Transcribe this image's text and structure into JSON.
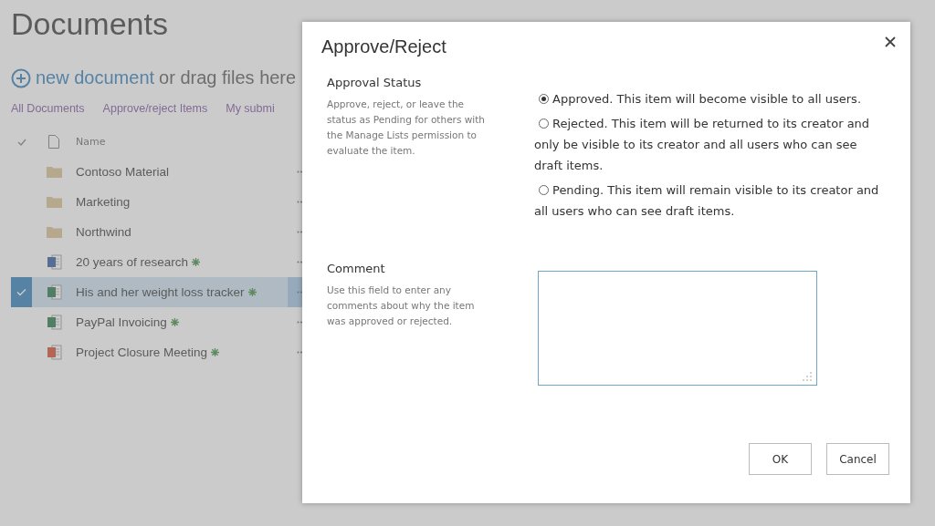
{
  "page": {
    "title": "Documents",
    "new_link": "new document",
    "new_hint": "or drag files here"
  },
  "views": [
    {
      "label": "All Documents"
    },
    {
      "label": "Approve/reject Items"
    },
    {
      "label": "My submi"
    }
  ],
  "list": {
    "column": "Name",
    "rows": [
      {
        "kind": "folder",
        "name": "Contoso Material",
        "new": false,
        "selected": false
      },
      {
        "kind": "folder",
        "name": "Marketing",
        "new": false,
        "selected": false
      },
      {
        "kind": "folder",
        "name": "Northwind",
        "new": false,
        "selected": false
      },
      {
        "kind": "word",
        "name": "20 years of research",
        "new": true,
        "selected": false
      },
      {
        "kind": "excel",
        "name": "His and her weight loss tracker",
        "new": true,
        "selected": true
      },
      {
        "kind": "excel",
        "name": "PayPal Invoicing",
        "new": true,
        "selected": false
      },
      {
        "kind": "powerpoint",
        "name": "Project Closure Meeting",
        "new": true,
        "selected": false
      }
    ]
  },
  "dialog": {
    "title": "Approve/Reject",
    "sections": [
      {
        "kind": "radios",
        "label": "Approval Status",
        "help": "Approve, reject, or leave the status as Pending for others with the Manage Lists permission to evaluate the item.",
        "options": [
          {
            "text": "Approved. This item will become visible to all users.",
            "selected": true
          },
          {
            "text": "Rejected. This item will be returned to its creator and only be visible to its creator and all users who can see draft items.",
            "selected": false
          },
          {
            "text": "Pending. This item will remain visible to its creator and all users who can see draft items.",
            "selected": false
          }
        ]
      },
      {
        "kind": "textarea",
        "label": "Comment",
        "help": "Use this field to enter any comments about why the item was approved or rejected."
      }
    ],
    "buttons": [
      "OK",
      "Cancel"
    ]
  }
}
